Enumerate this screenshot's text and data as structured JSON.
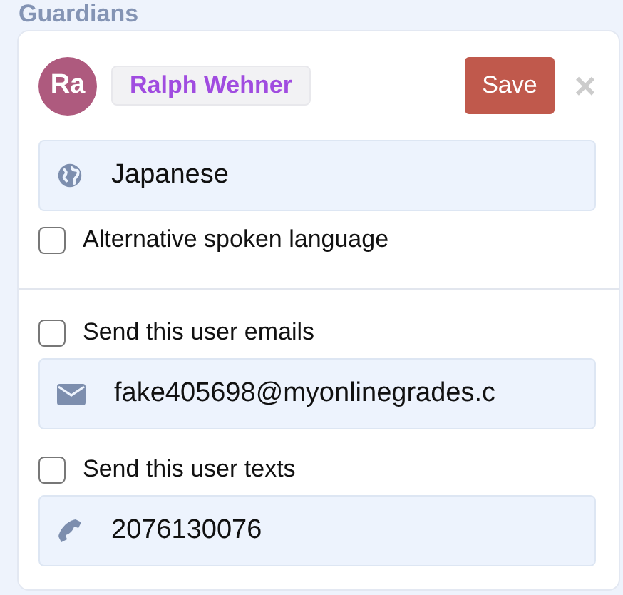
{
  "section_title": "Guardians",
  "guardian": {
    "initials": "Ra",
    "name": "Ralph Wehner"
  },
  "save_button": "Save",
  "close_button": "×",
  "language_field": {
    "value": "Japanese"
  },
  "alt_language": {
    "label": "Alternative spoken language",
    "checked": false
  },
  "email_option": {
    "label": "Send this user emails",
    "checked": false
  },
  "email_field": {
    "value": "fake405698@myonlinegrades.c"
  },
  "text_option": {
    "label": "Send this user texts",
    "checked": false
  },
  "phone_field": {
    "value": "2076130076"
  }
}
